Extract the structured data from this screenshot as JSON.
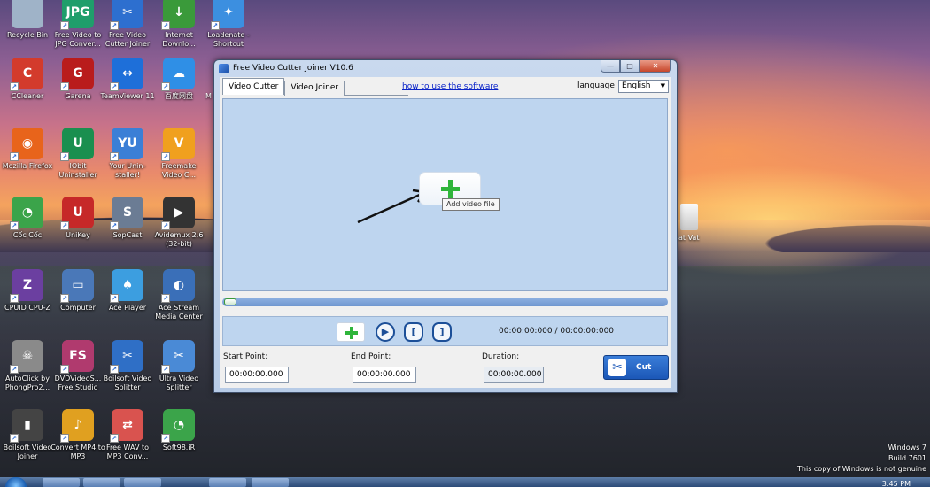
{
  "desktop": {
    "icons": [
      {
        "label": "Recycle Bin",
        "icon": "recycle-bin-icon",
        "color": "#9fb3c8"
      },
      {
        "label": "Free Video to JPG Conver...",
        "icon": "video-to-jpg-icon",
        "color": "#1f9e6b",
        "glyph": "JPG"
      },
      {
        "label": "Free Video Cutter Joiner",
        "icon": "video-cutter-icon",
        "color": "#2d6fcf",
        "glyph": "✂"
      },
      {
        "label": "Internet Downlo...",
        "icon": "idm-icon",
        "color": "#3a9a3a",
        "glyph": "↓"
      },
      {
        "label": "Loadenate - Shortcut",
        "icon": "loadenate-icon",
        "color": "#3c8fe0",
        "glyph": "✦"
      },
      {
        "label": "CCleaner",
        "icon": "ccleaner-icon",
        "color": "#d33b2c",
        "glyph": "C"
      },
      {
        "label": "Garena",
        "icon": "garena-icon",
        "color": "#b91c1c",
        "glyph": "G"
      },
      {
        "label": "TeamViewer 11",
        "icon": "teamviewer-icon",
        "color": "#1e6fd9",
        "glyph": "↔"
      },
      {
        "label": "百度网盘",
        "icon": "baidu-pan-icon",
        "color": "#2f8fe6",
        "glyph": "☁"
      },
      {
        "label": "Mozilla Firefox",
        "icon": "firefox-icon",
        "color": "#e8641b",
        "glyph": "◉"
      },
      {
        "label": "IObit Uninstaller",
        "icon": "iobit-icon",
        "color": "#1a8f4f",
        "glyph": "U"
      },
      {
        "label": "Your Unin-staller!",
        "icon": "your-uninstaller-icon",
        "color": "#3b7fd6",
        "glyph": "YU"
      },
      {
        "label": "Freemake Video C...",
        "icon": "freemake-icon",
        "color": "#f0a01e",
        "glyph": "V"
      },
      {
        "label": "Cốc Cốc",
        "icon": "coccoc-icon",
        "color": "#3ba44a",
        "glyph": "◔"
      },
      {
        "label": "UniKey",
        "icon": "unikey-icon",
        "color": "#c62828",
        "glyph": "U"
      },
      {
        "label": "SopCast",
        "icon": "sopcast-icon",
        "color": "#6b7c94",
        "glyph": "S"
      },
      {
        "label": "Avidemux 2.6 (32-bit)",
        "icon": "avidemux-icon",
        "color": "#333",
        "glyph": "▶"
      },
      {
        "label": "CPUID CPU-Z",
        "icon": "cpuz-icon",
        "color": "#6b3fa0",
        "glyph": "Z"
      },
      {
        "label": "Computer",
        "icon": "computer-icon",
        "color": "#4a78b8",
        "glyph": "▭"
      },
      {
        "label": "Ace Player",
        "icon": "ace-player-icon",
        "color": "#3c9ee0",
        "glyph": "♠"
      },
      {
        "label": "Ace Stream Media Center",
        "icon": "ace-stream-icon",
        "color": "#3a6fb8",
        "glyph": "◐"
      },
      {
        "label": "AutoClick by PhongPro2...",
        "icon": "autoclick-icon",
        "color": "#8a8a8a",
        "glyph": "☠"
      },
      {
        "label": "DVDVideoS... Free Studio",
        "icon": "dvdvideosoft-icon",
        "color": "#b03a6e",
        "glyph": "FS"
      },
      {
        "label": "Boilsoft Video Splitter",
        "icon": "boilsoft-splitter-icon",
        "color": "#2f6fc6",
        "glyph": "✂"
      },
      {
        "label": "Ultra Video Splitter",
        "icon": "ultra-splitter-icon",
        "color": "#4a8ad6",
        "glyph": "✂"
      },
      {
        "label": "Boilsoft Video Joiner",
        "icon": "boilsoft-joiner-icon",
        "color": "#444",
        "glyph": "▮"
      },
      {
        "label": "Convert MP4 to MP3",
        "icon": "mp4-to-mp3-icon",
        "color": "#e0a020",
        "glyph": "♪"
      },
      {
        "label": "Free WAV to MP3 Conv...",
        "icon": "wav-to-mp3-icon",
        "color": "#d9534f",
        "glyph": "⇄"
      },
      {
        "label": "Soft98.iR",
        "icon": "soft98-icon",
        "color": "#3ba44a",
        "glyph": "◔"
      }
    ],
    "partial_icon_label": "at Vat",
    "partial_left_label": "M",
    "watermark": {
      "line1": "Windows 7",
      "line2": "Build 7601",
      "line3": "This copy of Windows is not genuine"
    },
    "clock": "3:45 PM"
  },
  "window": {
    "title": "Free Video Cutter Joiner V10.6",
    "controls": {
      "minimize": "—",
      "maximize": "□",
      "close": "✕"
    },
    "tabs": [
      {
        "label": "Video Cutter",
        "active": true
      },
      {
        "label": "Video Joiner",
        "active": false
      }
    ],
    "help_link": "how to use the software",
    "language_label": "language",
    "language_value": "English",
    "preview": {
      "add_tooltip": "Add video file"
    },
    "timecode": "00:00:00:000 / 00:00:00:000",
    "start_point": {
      "label": "Start Point:",
      "value": "00:00:00.000"
    },
    "end_point": {
      "label": "End Point:",
      "value": "00:00:00.000"
    },
    "duration": {
      "label": "Duration:",
      "value": "00:00:00.000"
    },
    "cut_button": "Cut",
    "progress": 0,
    "colors": {
      "accent": "#1b57b7",
      "plus_green": "#2fb53b",
      "preview_bg": "#bed5ef"
    }
  }
}
